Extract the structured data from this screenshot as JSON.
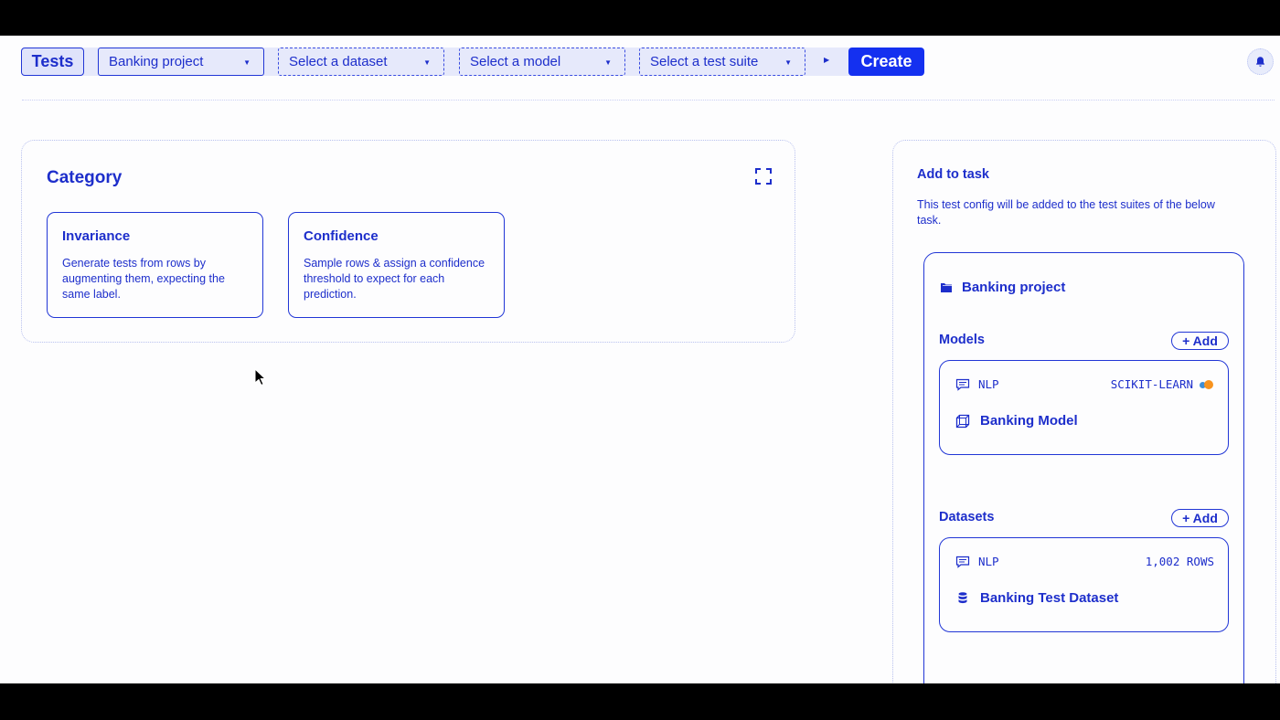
{
  "toolbar": {
    "tests_label": "Tests",
    "project_select": "Banking project",
    "dataset_select": "Select a dataset",
    "model_select": "Select a model",
    "suite_select": "Select a test suite",
    "create_label": "Create"
  },
  "category": {
    "title": "Category",
    "cards": [
      {
        "title": "Invariance",
        "description": "Generate tests from rows by augmenting them, expecting the same label."
      },
      {
        "title": "Confidence",
        "description": "Sample rows & assign a confidence threshold to expect for each prediction."
      }
    ]
  },
  "task": {
    "title": "Add to task",
    "description": "This test config will be added to the test suites of the below task.",
    "project": "Banking project",
    "models_label": "Models",
    "datasets_label": "Datasets",
    "add_label": "+ Add",
    "model": {
      "type": "NLP",
      "framework": "SCIKIT-LEARN",
      "name": "Banking Model"
    },
    "dataset": {
      "type": "NLP",
      "rows": "1,002 ROWS",
      "name": "Banking Test Dataset"
    }
  },
  "colors": {
    "accent": "#1d2ecb",
    "primary_button": "#1430f0",
    "toolbar_bg": "#e6e9fb",
    "page_bg": "#fdfdfe"
  },
  "icons": [
    "caret-down-icon",
    "caret-right-icon",
    "bell-icon",
    "expand-icon",
    "folder-icon",
    "chat-icon",
    "cube-icon",
    "database-icon",
    "scikit-learn-icon",
    "mouse-cursor-icon"
  ]
}
